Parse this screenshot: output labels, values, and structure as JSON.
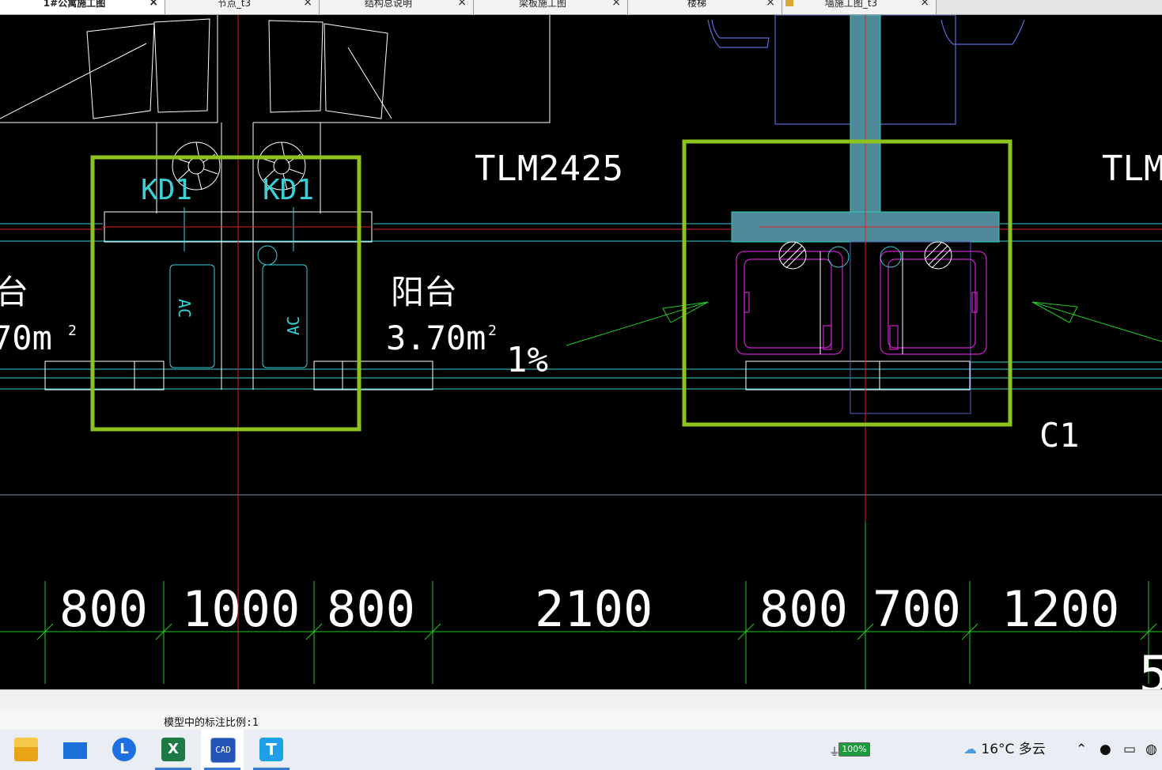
{
  "tabs": [
    {
      "label": "1#公寓施工图",
      "active": true
    },
    {
      "label": "节点_t3",
      "active": false
    },
    {
      "label": "结构总说明",
      "active": false
    },
    {
      "label": "梁板施工图",
      "active": false
    },
    {
      "label": "楼梯",
      "active": false
    },
    {
      "label": "墙施工图_t3",
      "active": false,
      "locked": true
    }
  ],
  "tab_close_glyph": "×",
  "drawing": {
    "door_label": "TLM2425",
    "door_label_partial": "TLM",
    "kd_left": "KD1",
    "kd_right": "KD1",
    "ac_left": "AC",
    "ac_right": "AC",
    "room_left_name_partial": "台",
    "room_left_area_partial": "70m",
    "room_name": "阳台",
    "room_area": "3.70m",
    "area_sup": "2",
    "slope": "1%",
    "window_label": "C1",
    "dims": [
      "800",
      "1000",
      "800",
      "2100",
      "800",
      "700",
      "1200"
    ],
    "dim_partial_bottom": "5"
  },
  "status": {
    "annotation_scale": "模型中的标注比例:1"
  },
  "taskbar": {
    "apps": [
      "file-explorer-icon",
      "mail-icon",
      "l-app-icon",
      "excel-icon",
      "cad-icon",
      "t-app-icon"
    ],
    "excel_letter": "X",
    "cad_text": "CAD",
    "t_letter": "T",
    "l_letter": "L",
    "battery": "100%",
    "weather": "16°C 多云"
  },
  "colors": {
    "highlight_box": "#8cc31e",
    "wall_fill": "#4f8a9a",
    "magenta": "#d020d0",
    "cyan": "#3ad0d8",
    "red_axis": "#e02020",
    "dim_green": "#22cc22",
    "blue_lines": "#5060c0"
  }
}
